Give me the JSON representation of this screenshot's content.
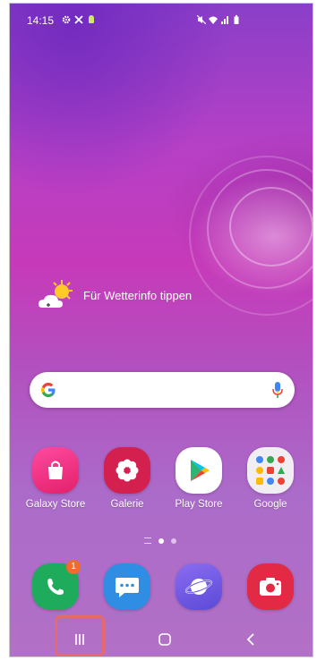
{
  "status_bar": {
    "time": "14:15",
    "left_icons": [
      "gear-icon",
      "tools-icon",
      "android-icon"
    ],
    "right_icons": [
      "mute-icon",
      "wifi-icon",
      "call-signal-icon",
      "battery-icon"
    ]
  },
  "weather": {
    "label": "Für Wetterinfo tippen",
    "icon": "sun-cloud-icon"
  },
  "search": {
    "logo": "google-g-icon",
    "mic": "microphone-icon"
  },
  "apps": [
    {
      "label": "Galaxy Store",
      "icon": "shopping-bag-icon",
      "color": "#e9307c"
    },
    {
      "label": "Galerie",
      "icon": "flower-icon",
      "color": "#d4204e"
    },
    {
      "label": "Play Store",
      "icon": "play-triangle-icon",
      "color": "#ffffff"
    },
    {
      "label": "Google",
      "icon": "google-folder-icon",
      "color": "#f0eef2"
    }
  ],
  "page_indicator": {
    "pages": 2,
    "active": 1
  },
  "dock": [
    {
      "name": "phone",
      "icon": "phone-icon",
      "color": "#1fab5c",
      "badge": "1"
    },
    {
      "name": "messages",
      "icon": "message-icon",
      "color": "#2f8de4"
    },
    {
      "name": "internet",
      "icon": "planet-icon",
      "color": "#6d59e6"
    },
    {
      "name": "camera",
      "icon": "camera-icon",
      "color": "#e22a45"
    }
  ],
  "nav": [
    "recents-icon",
    "home-icon",
    "back-icon"
  ],
  "colors": {
    "highlight": "#e66a6a",
    "badge": "#f26b2a"
  }
}
